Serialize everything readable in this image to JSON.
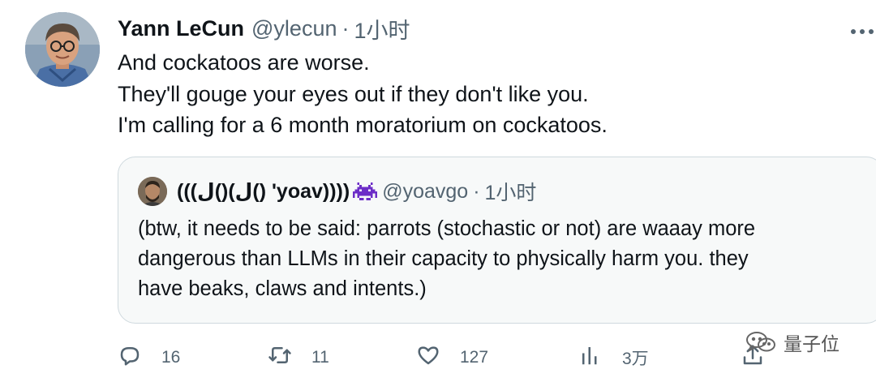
{
  "author": {
    "display_name": "Yann LeCun",
    "handle": "@ylecun",
    "separator": "·",
    "time": "1小时",
    "avatar": "avatar-photo"
  },
  "tweet": {
    "lines": [
      "And cockatoos are worse.",
      "They'll gouge your eyes out if they don't like you.",
      "I'm calling for a 6 month moratorium on cockatoos."
    ]
  },
  "quote": {
    "display_name": "(((ل()(ل() 'yoav))))",
    "badge_icon": "space-invader-icon",
    "handle": "@yoavgo",
    "separator": "·",
    "time": "1小时",
    "lines": [
      "(btw, it needs to be said: parrots (stochastic or not) are waaay more",
      "dangerous than LLMs in their capacity to physically harm you. they",
      "have beaks, claws and intents.)"
    ]
  },
  "actions": {
    "reply": {
      "icon": "reply-icon",
      "count": "16"
    },
    "retweet": {
      "icon": "retweet-icon",
      "count": "11"
    },
    "like": {
      "icon": "heart-icon",
      "count": "127"
    },
    "views": {
      "icon": "views-icon",
      "count": "3万"
    },
    "share": {
      "icon": "share-icon"
    }
  },
  "more_icon": "more-icon",
  "watermark": {
    "text": "量子位",
    "icon": "wechat-icon"
  },
  "colors": {
    "text_primary": "#0f1419",
    "text_secondary": "#536471",
    "quote_border": "#cfd9de",
    "quote_bg": "#f7f9f9",
    "badge": "#6c2dc7"
  }
}
